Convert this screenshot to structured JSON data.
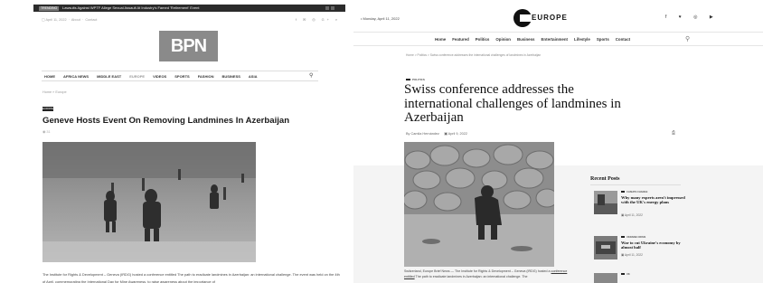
{
  "left": {
    "ticker": {
      "tag": "TRENDING",
      "headline": "Lawsuits Against WPTF Allege Sexual Assault At Industry's Famed 'Retirement' Event"
    },
    "meta": {
      "date": "April 11, 2022",
      "links": [
        "About",
        "Contact"
      ],
      "social": "f ✉ ◎ G+ ⌕"
    },
    "logo": "BPN",
    "nav": [
      "HOME",
      "AFRICA NEWS",
      "MIDDLE EAST",
      "EUROPE",
      "VIDEOS",
      "SPORTS",
      "FASHION",
      "BUSINESS",
      "ASIA"
    ],
    "breadcrumb": "Home  »  Europe",
    "badge": "EUROPE",
    "title": "Geneve Hosts Event On Removing Landmines In Azerbaijan",
    "views": "◉ 31",
    "body": "The Institute for Rights & Development – Geneva (IRDG) hosted a conference entitled The path to eradicate landmines in Azerbaijan: an international challenge. The event was held on the 4th of April, commemorating the International Day for Mine Awareness, to raise awareness about the importance of"
  },
  "right": {
    "date": "• Monday, April 11, 2022",
    "logo": "EUROPE",
    "social": "f ♥ ◎ ▶",
    "nav": [
      "Home",
      "Featured",
      "Politics",
      "Opinion",
      "Business",
      "Entertainment",
      "Lifestyle",
      "Sports",
      "Contact"
    ],
    "breadcrumb": "Home  >  Politics  >  Swiss conference addresses the international challenges of landmines in Azerbaijan",
    "category": "POLITICS",
    "title": "Swiss conference addresses the international challenges of landmines in Azerbaijan",
    "author": "By Camila Hernández",
    "date_published": "April 9, 2022",
    "body_start": "Switzerland, Europe Brief News — The Institute for Rights & Development – Geneva (IRDG) hosted a ",
    "body_link": "conference entitled",
    "body_end": " The path to eradicate landmines in Azerbaijan: an international challenge. The",
    "recent_heading": "Recent Posts",
    "recent_posts": [
      {
        "category": "CLIMATE CHANGE",
        "title": "Why many experts aren't impressed with the UK's energy plans",
        "date": "April 11, 2022"
      },
      {
        "category": "UKRAINE CRISIS",
        "title": "War to cut Ukraine's economy by almost half",
        "date": "April 11, 2022"
      },
      {
        "category": "UK",
        "title": "",
        "date": ""
      }
    ]
  }
}
